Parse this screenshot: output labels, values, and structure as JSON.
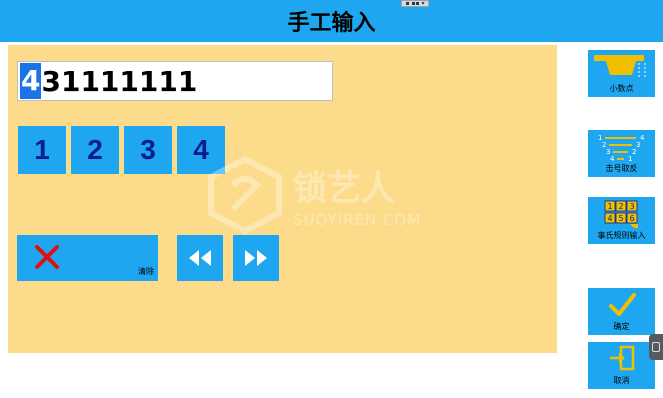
{
  "header": {
    "title": "手工输入",
    "handle_text": "▪ ▪▪ ▾"
  },
  "entry": {
    "cursor_char": "4",
    "rest": "31111111"
  },
  "keypad": {
    "keys": [
      "1",
      "2",
      "3",
      "4"
    ]
  },
  "clear": {
    "label": "清除"
  },
  "sidebar": {
    "decimal_label": "小数点",
    "reverse_label": "击号取反",
    "rule_label": "事氏规则输入",
    "confirm_label": "确定",
    "cancel_label": "取消"
  },
  "watermark": {
    "main": "锁艺人",
    "sub": "SUOYIREN.COM"
  },
  "colors": {
    "accent": "#1ea7f0",
    "panel": "#fcdc8a",
    "key_text": "#0b1e8c",
    "clear_x": "#e01010",
    "icon_yellow": "#f0c000"
  },
  "icons": {
    "clear": "close-icon",
    "left": "rewind-icon",
    "right": "fast-forward-icon",
    "decimal": "decimal-point-icon",
    "reverse": "reverse-order-icon",
    "rule": "numeric-grid-icon",
    "confirm": "checkmark-icon",
    "cancel": "exit-icon"
  }
}
